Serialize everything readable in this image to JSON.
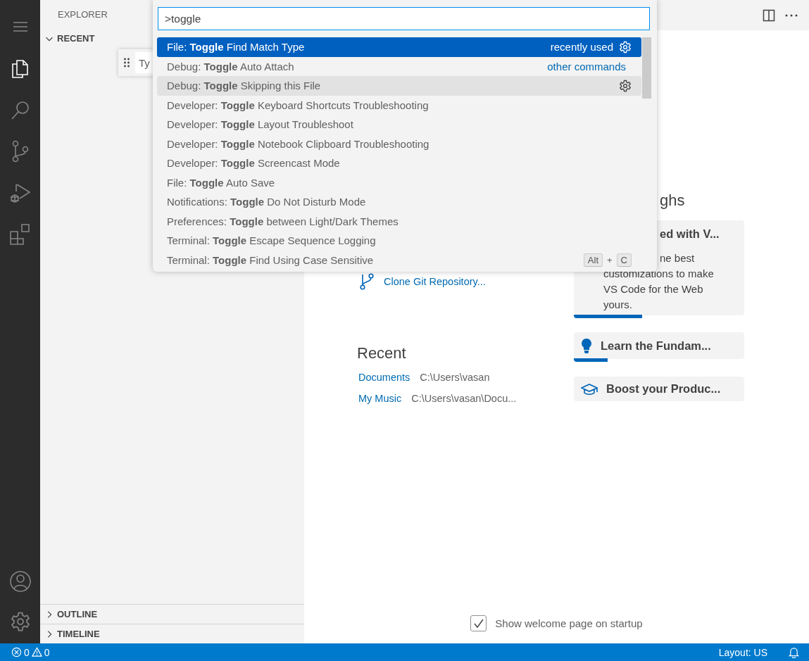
{
  "activity_bar": {
    "items": [
      {
        "kind": "files",
        "selected": true
      },
      {
        "kind": "search",
        "selected": false
      },
      {
        "kind": "source-control",
        "selected": false
      },
      {
        "kind": "run-debug",
        "selected": false
      },
      {
        "kind": "extensions",
        "selected": false
      }
    ]
  },
  "sidebar": {
    "title": "EXPLORER",
    "sections": [
      {
        "label": "RECENT",
        "expanded": true
      },
      {
        "label": "OUTLINE",
        "expanded": false
      },
      {
        "label": "TIMELINE",
        "expanded": false
      }
    ],
    "floating_field": {
      "value": "Ty"
    }
  },
  "command_palette": {
    "query": ">toggle",
    "items": [
      {
        "label": "File: **Toggle** Find Match Type",
        "selected": true,
        "hovered": false,
        "detail": "recently used",
        "gear": true
      },
      {
        "label": "Debug: **Toggle** Auto Attach",
        "selected": false,
        "hovered": false,
        "detail": "other commands",
        "gear": false
      },
      {
        "label": "Debug: **Toggle** Skipping this File",
        "selected": false,
        "hovered": true,
        "gear": true
      },
      {
        "label": "Developer: **Toggle** Keyboard Shortcuts Troubleshooting",
        "selected": false,
        "hovered": false,
        "gear": false
      },
      {
        "label": "Developer: **Toggle** Layout Troubleshoot",
        "selected": false,
        "hovered": false,
        "gear": false
      },
      {
        "label": "Developer: **Toggle** Notebook Clipboard Troubleshooting",
        "selected": false,
        "hovered": false,
        "gear": false
      },
      {
        "label": "Developer: **Toggle** Screencast Mode",
        "selected": false,
        "hovered": false,
        "gear": false
      },
      {
        "label": "File: **Toggle** Auto Save",
        "selected": false,
        "hovered": false,
        "gear": false
      },
      {
        "label": "Notifications: **Toggle** Do Not Disturb Mode",
        "selected": false,
        "hovered": false,
        "gear": false
      },
      {
        "label": "Preferences: **Toggle** between Light/Dark Themes",
        "selected": false,
        "hovered": false,
        "gear": false
      },
      {
        "label": "Terminal: **Toggle** Escape Sequence Logging",
        "selected": false,
        "hovered": false,
        "gear": false
      },
      {
        "label": "Terminal: **Toggle** Find Using Case Sensitive",
        "selected": false,
        "hovered": false,
        "gear": false,
        "keybinding": {
          "keys": [
            "Alt",
            "C"
          ],
          "joiner": "+"
        }
      }
    ]
  },
  "welcome": {
    "start": [
      {
        "label": "Clone Git Repository..."
      }
    ],
    "recent": {
      "title": "Recent",
      "items": [
        {
          "name": "Documents",
          "path": "C:\\Users\\vasan"
        },
        {
          "name": "My Music",
          "path": "C:\\Users\\vasan\\Docu..."
        }
      ]
    },
    "walkthroughs": {
      "title": "ghs",
      "cards": [
        {
          "kind": "hidden-icon",
          "title": "ed with V...",
          "lines": [
            "ne best",
            "customizations to make",
            "VS Code for the Web",
            "yours."
          ],
          "level": 0.4
        },
        {
          "kind": "bulb",
          "title": "Learn the Fundam...",
          "level": 0.2
        },
        {
          "kind": "mortarboard",
          "title": "Boost your Produc..."
        }
      ]
    },
    "show_on_startup": {
      "label": "Show welcome page on startup",
      "checked": true
    }
  },
  "status_bar": {
    "errors": "0",
    "warnings": "0",
    "layout": "Layout: US"
  }
}
